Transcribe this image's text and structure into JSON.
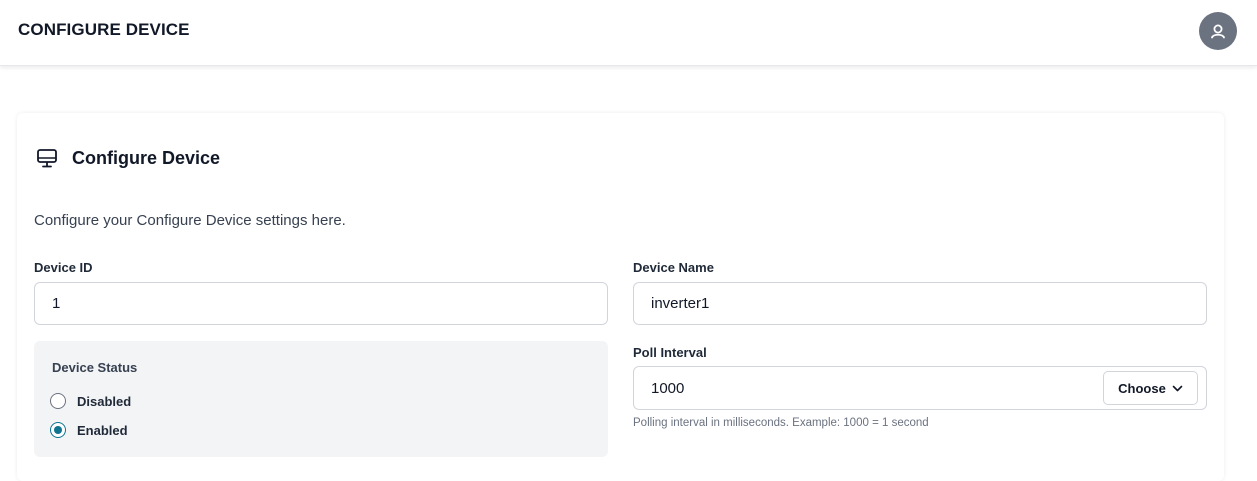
{
  "header": {
    "title": "CONFIGURE DEVICE",
    "avatar_icon": "user-icon",
    "avatar_color": "#6b7280"
  },
  "card": {
    "icon": "monitor-icon",
    "title": "Configure Device",
    "description": "Configure your Configure Device settings here."
  },
  "form": {
    "device_id": {
      "label": "Device ID",
      "value": "1"
    },
    "device_name": {
      "label": "Device Name",
      "value": "inverter1"
    },
    "device_status": {
      "label": "Device Status",
      "options": [
        {
          "label": "Disabled",
          "selected": false
        },
        {
          "label": "Enabled",
          "selected": true
        }
      ]
    },
    "poll_interval": {
      "label": "Poll Interval",
      "value": "1000",
      "choose_label": "Choose",
      "hint": "Polling interval in milliseconds. Example: 1000 = 1 second"
    }
  },
  "colors": {
    "radio_accent": "#0e7490",
    "status_panel_bg": "#f3f4f6"
  }
}
